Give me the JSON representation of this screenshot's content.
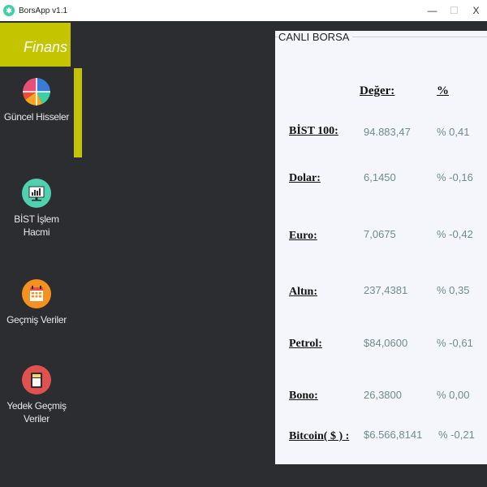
{
  "window": {
    "title": "BorsApp v1.1",
    "min_glyph": "—",
    "max_glyph": "☐",
    "close_glyph": "X"
  },
  "sidebar": {
    "brand": "Finans",
    "items": [
      {
        "label": "Güncel Hisseler",
        "icon": "pie-chart-icon",
        "active": true
      },
      {
        "label": "BİST İşlem Hacmi",
        "icon": "monitor-chart-icon"
      },
      {
        "label": "Geçmiş Veriler",
        "icon": "calendar-icon"
      },
      {
        "label": "Yedek Geçmiş Veriler",
        "icon": "sd-card-icon"
      }
    ]
  },
  "panel": {
    "title": "CANLI BORSA",
    "headers": {
      "value": "Değer:",
      "pct": "%"
    },
    "rows": [
      {
        "label": "BİST 100:",
        "value": "94.883,47",
        "pct": "% 0,41"
      },
      {
        "label": "Dolar:",
        "value": "6,1450",
        "pct": "% -0,16"
      },
      {
        "label": "Euro:",
        "value": "7,0675",
        "pct": "% -0,42"
      },
      {
        "label": "Altın:",
        "value": "237,4381",
        "pct": "% 0,35"
      },
      {
        "label": "Petrol:",
        "value": "$84,0600",
        "pct": "% -0,61"
      },
      {
        "label": "Bono:",
        "value": "26,3800",
        "pct": "% 0,00"
      },
      {
        "label": "Bitcoin( $ ) :",
        "value": "$6.566,8141",
        "pct": "% -0,21"
      }
    ]
  },
  "colors": {
    "accent": "#c4c400",
    "background": "#2b2d31",
    "panel": "#f5f6fb",
    "value_text": "#6d8c8c"
  }
}
